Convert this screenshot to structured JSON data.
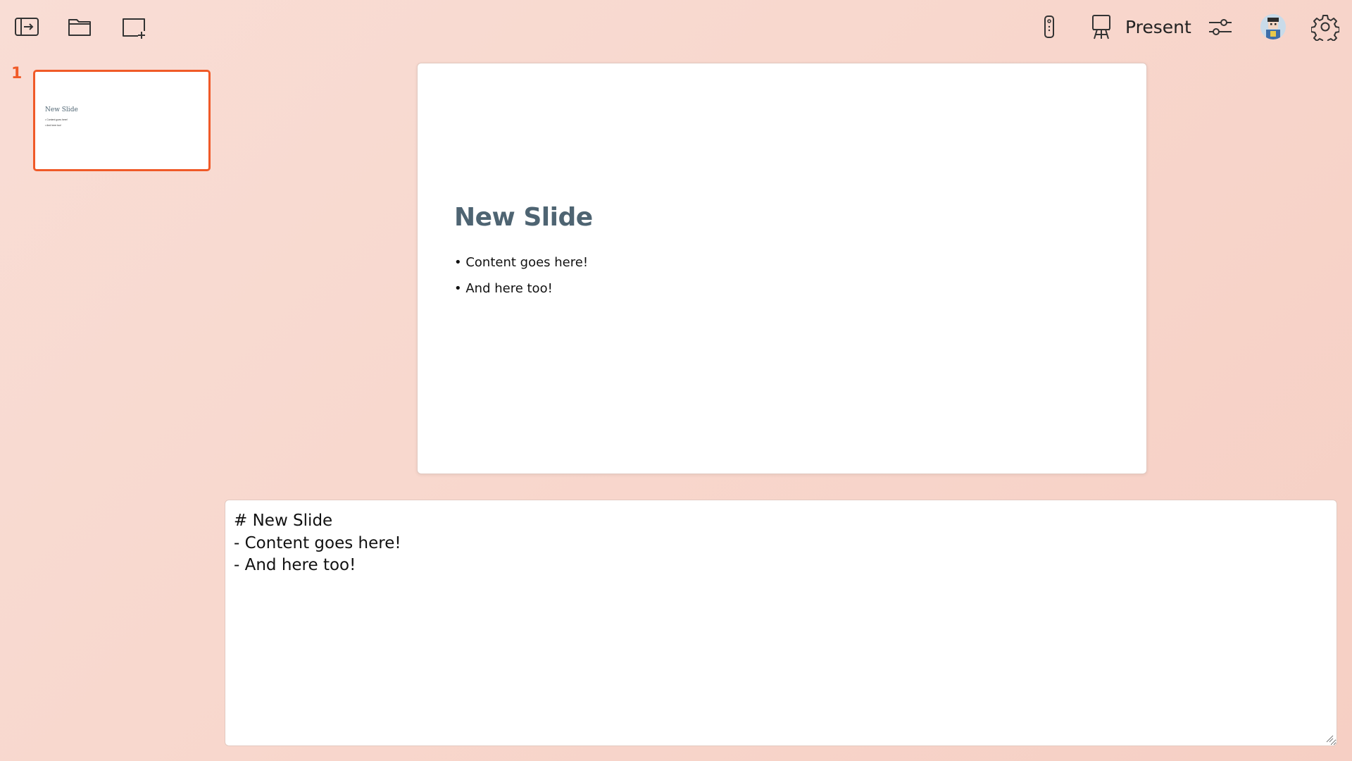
{
  "toolbar": {
    "present_label": "Present",
    "icons": {
      "sidebar": "sidebar-toggle-icon",
      "open": "folder-icon",
      "new_slide": "new-slide-icon",
      "remote": "remote-control-icon",
      "present": "easel-icon",
      "adjust": "sliders-icon",
      "avatar": "user-avatar",
      "settings": "gear-icon"
    }
  },
  "slides": [
    {
      "number": "1",
      "title": "New Slide",
      "bullets": [
        "Content goes here!",
        "And here too!"
      ]
    }
  ],
  "current_slide": {
    "title": "New Slide",
    "bullets": [
      "Content goes here!",
      "And here too!"
    ]
  },
  "editor": {
    "lines": [
      "# New Slide",
      "- Content goes here!",
      "- And here too!"
    ]
  },
  "colors": {
    "accent": "#f05a28",
    "slide_title": "#4e6472",
    "background": "#f8d8ce"
  }
}
